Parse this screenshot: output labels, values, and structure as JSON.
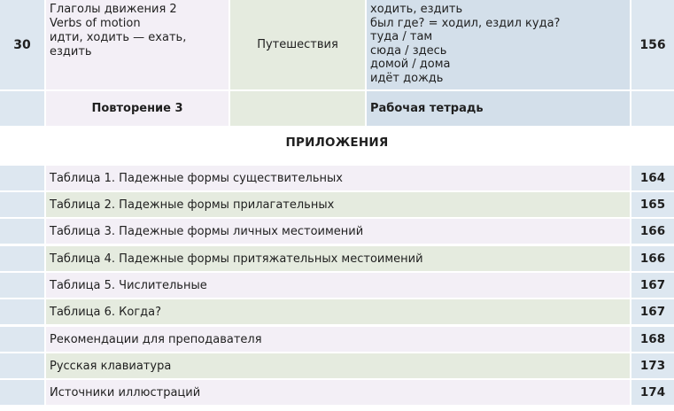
{
  "lesson": {
    "number": "30",
    "topic_lines": [
      "Глаголы движения 2",
      "Verbs of motion",
      "идти, ходить — ехать, ездить"
    ],
    "theme": "Путешествия",
    "notes_lines": [
      "ходить, ездить",
      "был где? = ходил, ездил куда?",
      "туда / там",
      "сюда / здесь",
      "домой / дома",
      "идёт дождь"
    ],
    "page": "156"
  },
  "review": {
    "label": "Повторение 3",
    "workbook": "Рабочая тетрадь"
  },
  "appendix": {
    "title": "ПРИЛОЖЕНИЯ",
    "items": [
      {
        "label": "Таблица 1. Падежные формы существительных",
        "page": "164"
      },
      {
        "label": "Таблица 2. Падежные формы прилагательных",
        "page": "165"
      },
      {
        "label": "Таблица 3. Падежные формы личных местоимений",
        "page": "166"
      },
      {
        "label": "Таблица 4. Падежные формы притяжательных местоимений",
        "page": "166"
      },
      {
        "label": "Таблица 5. Числительные",
        "page": "167"
      },
      {
        "label": "Таблица 6. Когда?",
        "page": "167"
      },
      {
        "label": "Рекомендации для преподавателя",
        "page": "168"
      },
      {
        "label": "Русская клавиатура",
        "page": "173"
      },
      {
        "label": "Источники иллюстраций",
        "page": "174"
      }
    ]
  }
}
